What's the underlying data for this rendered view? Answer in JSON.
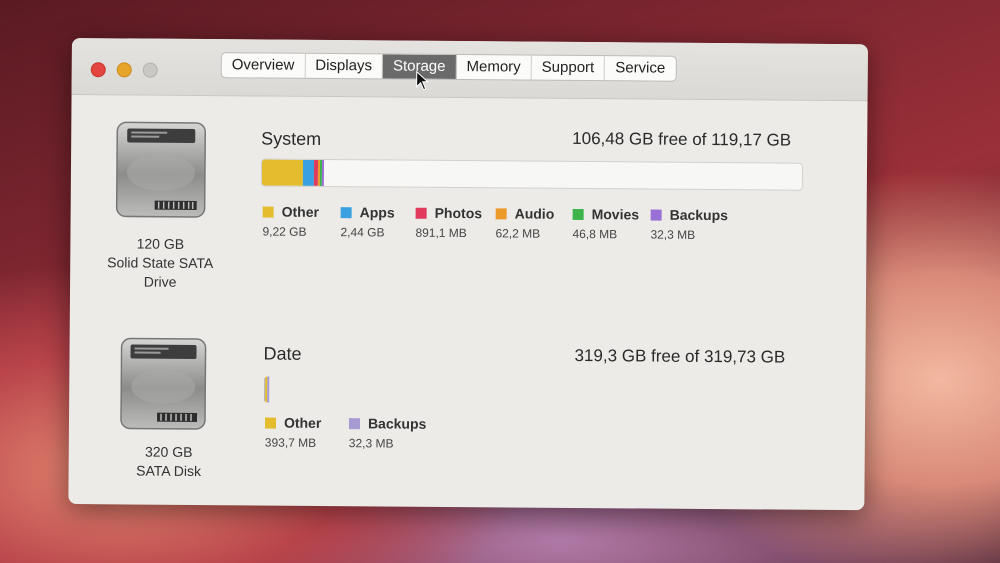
{
  "window": {
    "tabs": [
      {
        "label": "Overview",
        "active": false
      },
      {
        "label": "Displays",
        "active": false
      },
      {
        "label": "Storage",
        "active": true
      },
      {
        "label": "Memory",
        "active": false
      },
      {
        "label": "Support",
        "active": false
      },
      {
        "label": "Service",
        "active": false
      }
    ]
  },
  "drives": [
    {
      "label_line1": "120 GB",
      "label_line2": "Solid State SATA",
      "label_line3": "Drive",
      "icon": "hard-drive-icon",
      "volume_name": "System",
      "free_text": "106,48 GB free of 119,17 GB",
      "used_fraction": 0.106,
      "categories": [
        {
          "name": "Other",
          "size": "9,22 GB",
          "color": "#e3bd2e",
          "share": 0.72
        },
        {
          "name": "Apps",
          "size": "2,44 GB",
          "color": "#3aa0e0",
          "share": 0.19
        },
        {
          "name": "Photos",
          "size": "891,1 MB",
          "color": "#e23a5a",
          "share": 0.07
        },
        {
          "name": "Audio",
          "size": "62,2 MB",
          "color": "#ec9a2c",
          "share": 0.005
        },
        {
          "name": "Movies",
          "size": "46,8 MB",
          "color": "#3cb44a",
          "share": 0.004
        },
        {
          "name": "Backups",
          "size": "32,3 MB",
          "color": "#9a6fd6",
          "share": 0.003
        }
      ]
    },
    {
      "label_line1": "320 GB",
      "label_line2": "SATA Disk",
      "icon": "hard-drive-icon",
      "volume_name": "Date",
      "free_text": "319,3 GB free of 319,73 GB",
      "used_fraction": 0.0013,
      "categories": [
        {
          "name": "Other",
          "size": "393,7 MB",
          "color": "#e3bd2e",
          "share": 0.92
        },
        {
          "name": "Backups",
          "size": "32,3 MB",
          "color": "#a79ad2",
          "share": 0.08
        }
      ]
    }
  ]
}
